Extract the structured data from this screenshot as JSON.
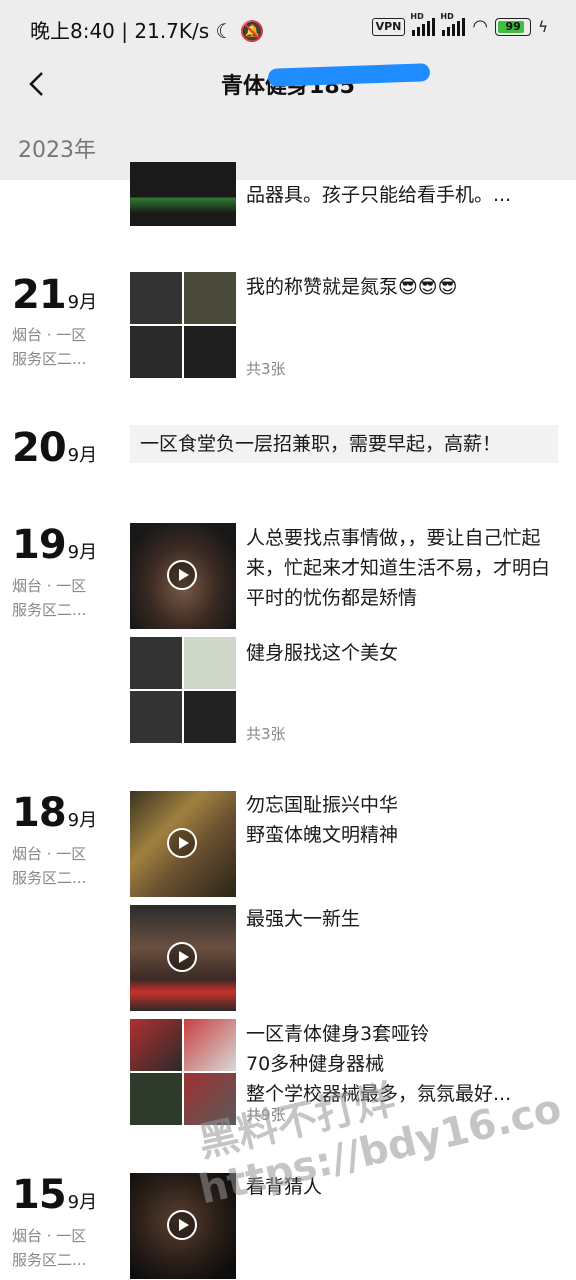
{
  "status_bar": {
    "time_speed": "晚上8:40 | 21.7K/s",
    "vpn": "VPN",
    "hd": "HD",
    "battery": "99"
  },
  "nav": {
    "title": "青体健身185"
  },
  "year_header": "2023年",
  "entries": [
    {
      "text": "品器具。孩子只能给看手机。..."
    },
    {
      "day": "21",
      "month": "9月",
      "location1": "烟台 · 一区",
      "location2": "服务区二...",
      "text": "我的称赞就是氮泵😎😎😎",
      "count": "共3张"
    },
    {
      "day": "20",
      "month": "9月",
      "text": "一区食堂负一层招兼职，需要早起，高薪！"
    },
    {
      "day": "19",
      "month": "9月",
      "location1": "烟台 · 一区",
      "location2": "服务区二...",
      "posts": [
        {
          "text": "人总要找点事情做，，要让自己忙起来，忙起来才知道生活不易，才明白平时的忧伤都是矫情"
        },
        {
          "text": "健身服找这个美女",
          "count": "共3张"
        }
      ]
    },
    {
      "day": "18",
      "month": "9月",
      "location1": "烟台 · 一区",
      "location2": "服务区二...",
      "posts": [
        {
          "line1": "勿忘国耻振兴中华",
          "line2": "野蛮体魄文明精神"
        },
        {
          "text": "最强大一新生"
        },
        {
          "line1": "一区青体健身3套哑铃",
          "line2": "70多种健身器械",
          "line3": "整个学校器械最多，氛氛最好...",
          "count": "共9张"
        }
      ]
    },
    {
      "day": "15",
      "month": "9月",
      "location1": "烟台 · 一区",
      "location2": "服务区二...",
      "text": "看背猜人"
    }
  ],
  "watermark": {
    "line1": "黑料不打烊",
    "line2": "https://bdy16.co"
  }
}
